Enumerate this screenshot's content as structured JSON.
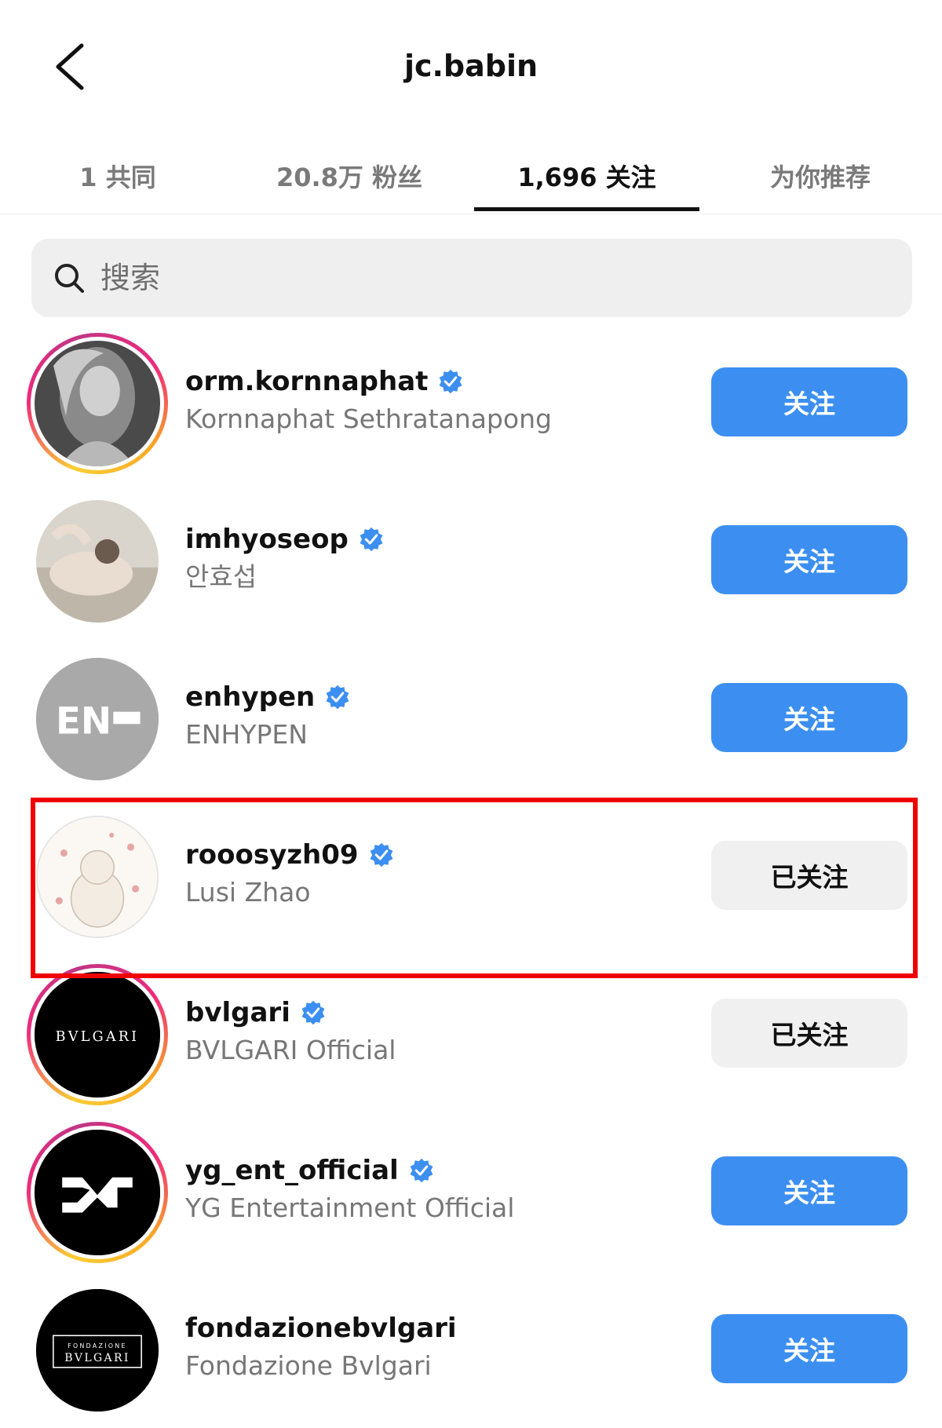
{
  "header": {
    "title": "jc.babin"
  },
  "tabs": [
    {
      "label": "1 共同"
    },
    {
      "label": "20.8万 粉丝"
    },
    {
      "label": "1,696 关注"
    },
    {
      "label": "为你推荐"
    }
  ],
  "search": {
    "placeholder": "搜索"
  },
  "accent_color": "#3c8ff0",
  "highlight_color": "#f00000",
  "accounts": [
    {
      "username": "orm.kornnaphat",
      "full_name": "Kornnaphat Sethratanapong",
      "button": "关注",
      "verified": true
    },
    {
      "username": "imhyoseop",
      "full_name": "안효섭",
      "button": "关注",
      "verified": true
    },
    {
      "username": "enhypen",
      "full_name": "ENHYPEN",
      "button": "关注",
      "verified": true,
      "avatar_text": "EN"
    },
    {
      "username": "rooosyzh09",
      "full_name": "Lusi Zhao",
      "button": "已关注",
      "verified": true
    },
    {
      "username": "bvlgari",
      "full_name": "BVLGARI Official",
      "button": "已关注",
      "verified": true,
      "avatar_text": "BVLGARI"
    },
    {
      "username": "yg_ent_official",
      "full_name": "YG Entertainment Official",
      "button": "关注",
      "verified": true
    },
    {
      "username": "fondazionebvlgari",
      "full_name": "Fondazione Bvlgari",
      "button": "关注",
      "verified": false,
      "avatar_text": [
        "FONDAZIONE",
        "BVLGARI"
      ]
    }
  ]
}
